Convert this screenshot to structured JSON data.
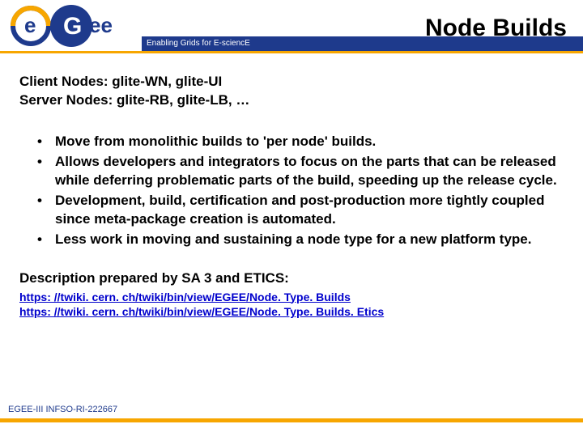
{
  "header": {
    "title": "Node Builds",
    "tagline": "Enabling Grids for E-sciencE"
  },
  "logo": {
    "text_top": "e",
    "text_bottom": "ee",
    "letter_g": "G"
  },
  "nodelines": {
    "client": "Client Nodes:  glite-WN, glite-UI",
    "server": "Server Nodes: glite-RB, glite-LB, …"
  },
  "bullets": [
    "Move from monolithic builds to 'per node' builds.",
    "Allows developers and integrators to focus on the parts that can be released while deferring problematic parts of the build, speeding up the release cycle.",
    "Development, build, certification and post-production more tightly coupled since meta-package creation is automated.",
    "Less work in moving and sustaining a node type for a new platform type."
  ],
  "desc": "Description prepared by SA 3 and ETICS:",
  "links": [
    "https: //twiki. cern. ch/twiki/bin/view/EGEE/Node. Type. Builds",
    "https: //twiki. cern. ch/twiki/bin/view/EGEE/Node. Type. Builds. Etics"
  ],
  "footer": "EGEE-III INFSO-RI-222667"
}
